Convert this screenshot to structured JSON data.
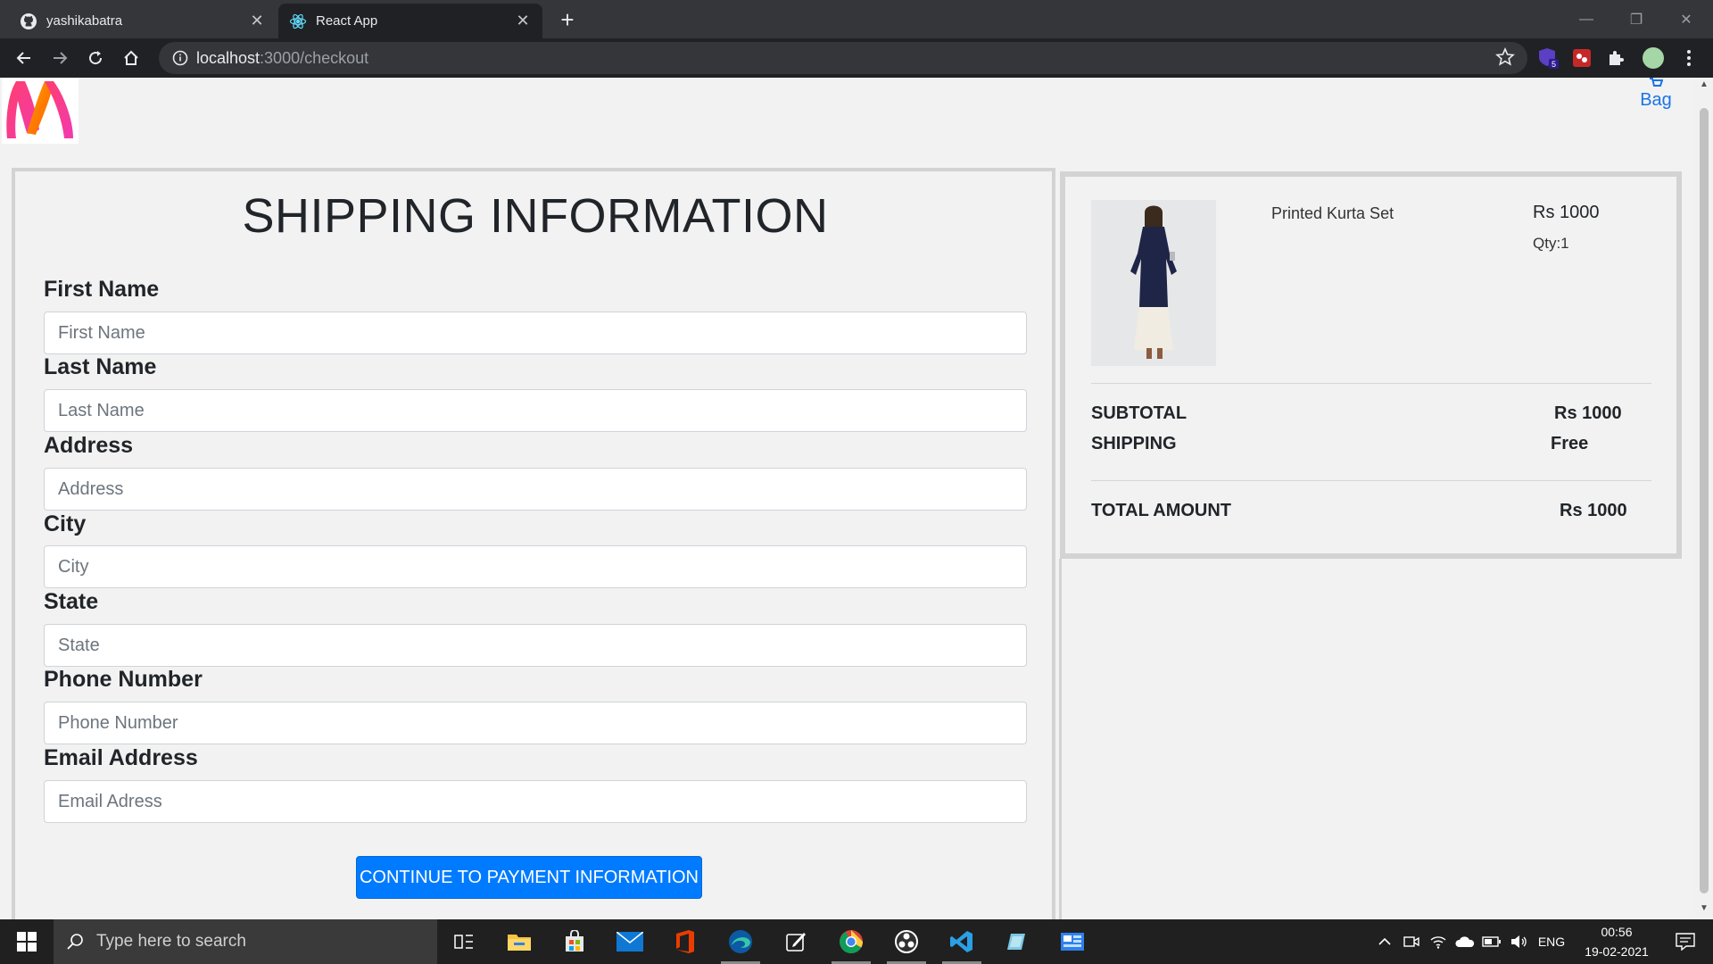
{
  "browser": {
    "tabs": [
      {
        "title": "yashikabatra",
        "icon": "github-icon"
      },
      {
        "title": "React App",
        "icon": "react-icon"
      }
    ],
    "url_host": "localhost",
    "url_path": ":3000/checkout"
  },
  "header": {
    "bag_label": "Bag"
  },
  "form": {
    "title": "SHIPPING INFORMATION",
    "fields": [
      {
        "label": "First Name",
        "placeholder": "First Name"
      },
      {
        "label": "Last Name",
        "placeholder": "Last Name"
      },
      {
        "label": "Address",
        "placeholder": "Address"
      },
      {
        "label": "City",
        "placeholder": "City"
      },
      {
        "label": "State",
        "placeholder": "State"
      },
      {
        "label": "Phone Number",
        "placeholder": "Phone Number"
      },
      {
        "label": "Email Address",
        "placeholder": "Email Adress"
      }
    ],
    "continue_label": "CONTINUE TO PAYMENT INFORMATION"
  },
  "order": {
    "item": {
      "name": "Printed Kurta Set",
      "price": "Rs 1000",
      "qty": "Qty:1"
    },
    "subtotal_label": "SUBTOTAL",
    "subtotal_value": "Rs 1000",
    "shipping_label": "SHIPPING",
    "shipping_value": "Free",
    "total_label": "TOTAL AMOUNT",
    "total_value": "Rs 1000"
  },
  "taskbar": {
    "search_placeholder": "Type here to search",
    "language": "ENG",
    "time": "00:56",
    "date": "19-02-2021",
    "extension_badge": "5"
  },
  "colors": {
    "primary": "#007bff",
    "link": "#1a73e8",
    "border": "#d3d3d3"
  }
}
